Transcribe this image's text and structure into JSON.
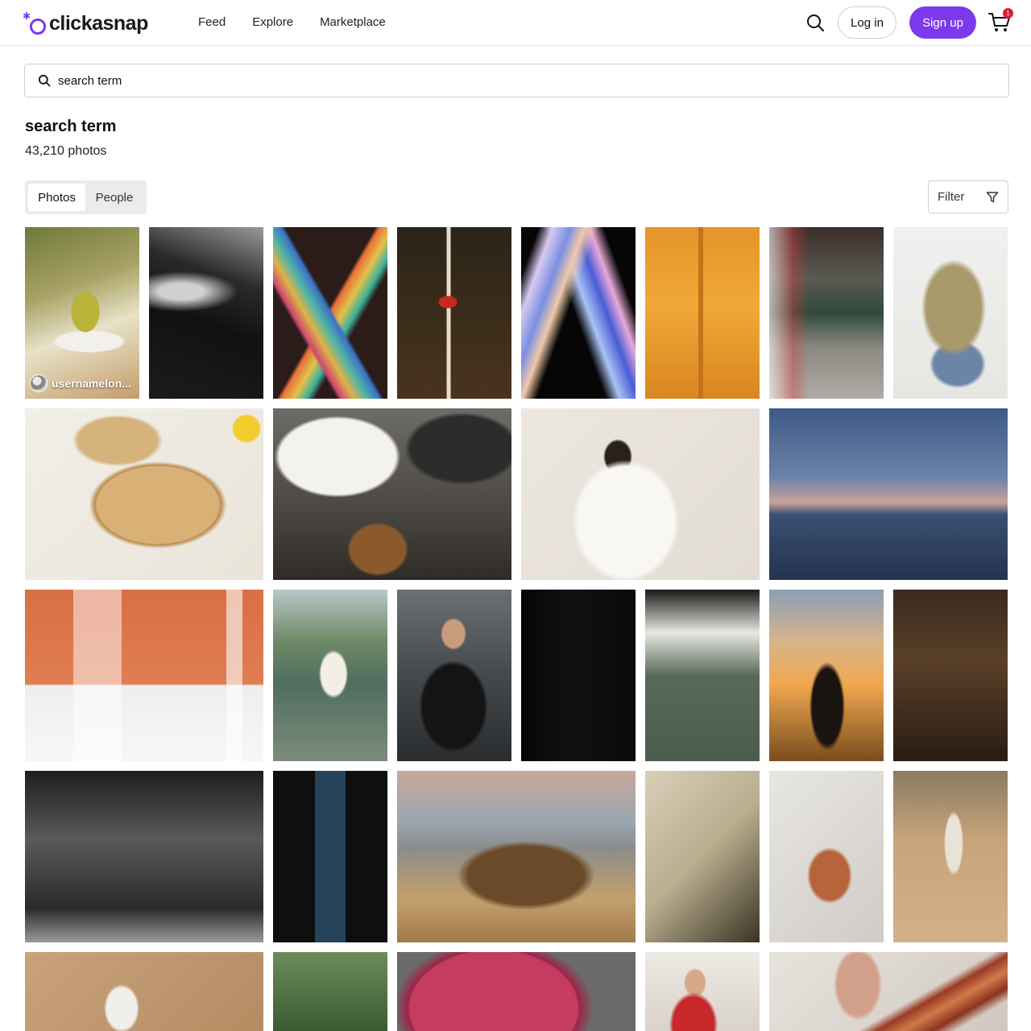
{
  "brand": {
    "name": "clickasnap",
    "accent": "#7c3aed"
  },
  "nav": {
    "items": [
      "Feed",
      "Explore",
      "Marketplace"
    ]
  },
  "header": {
    "login_label": "Log in",
    "signup_label": "Sign up",
    "cart_count": "1"
  },
  "search": {
    "value": "search term"
  },
  "results": {
    "title": "search term",
    "count": "43,210",
    "count_suffix": "photos"
  },
  "tabs": {
    "items": [
      "Photos",
      "People"
    ],
    "active": "Photos"
  },
  "filter": {
    "label": "Filter"
  },
  "photos": [
    {
      "subject": "pear-on-plate-with-book",
      "owner": "usernamelon..."
    },
    {
      "subject": "black-sea-waves-on-rocks"
    },
    {
      "subject": "rainbow-chain-links"
    },
    {
      "subject": "red-mushroom-forest-floor"
    },
    {
      "subject": "holographic-ice-pops"
    },
    {
      "subject": "orange-wall-shadows"
    },
    {
      "subject": "subway-station-motion-blur"
    },
    {
      "subject": "man-in-jacket-pose"
    },
    {
      "subject": "bao-buns-in-steamer"
    },
    {
      "subject": "seafood-dishes-table"
    },
    {
      "subject": "woman-in-white-dress"
    },
    {
      "subject": "beach-at-dusk"
    },
    {
      "subject": "acrylic-shapes-on-orange"
    },
    {
      "subject": "hand-holding-soda-can-lake"
    },
    {
      "subject": "chef-chopping-food"
    },
    {
      "subject": "dark-corridor"
    },
    {
      "subject": "aerial-store-interior"
    },
    {
      "subject": "silhouette-at-sunset"
    },
    {
      "subject": "graffiti-bench-shadow"
    },
    {
      "subject": "office-building-night"
    },
    {
      "subject": "telephone-booth-night"
    },
    {
      "subject": "rocky-shore-long-exposure"
    },
    {
      "subject": "abstract-beige-curves"
    },
    {
      "subject": "clay-pot-on-white"
    },
    {
      "subject": "woman-walking-desert"
    },
    {
      "subject": "coffee-cup-in-sand"
    },
    {
      "subject": "green-plants-greenhouse"
    },
    {
      "subject": "pink-balloon-shape"
    },
    {
      "subject": "woman-red-sweater"
    },
    {
      "subject": "bacon-and-card"
    }
  ]
}
